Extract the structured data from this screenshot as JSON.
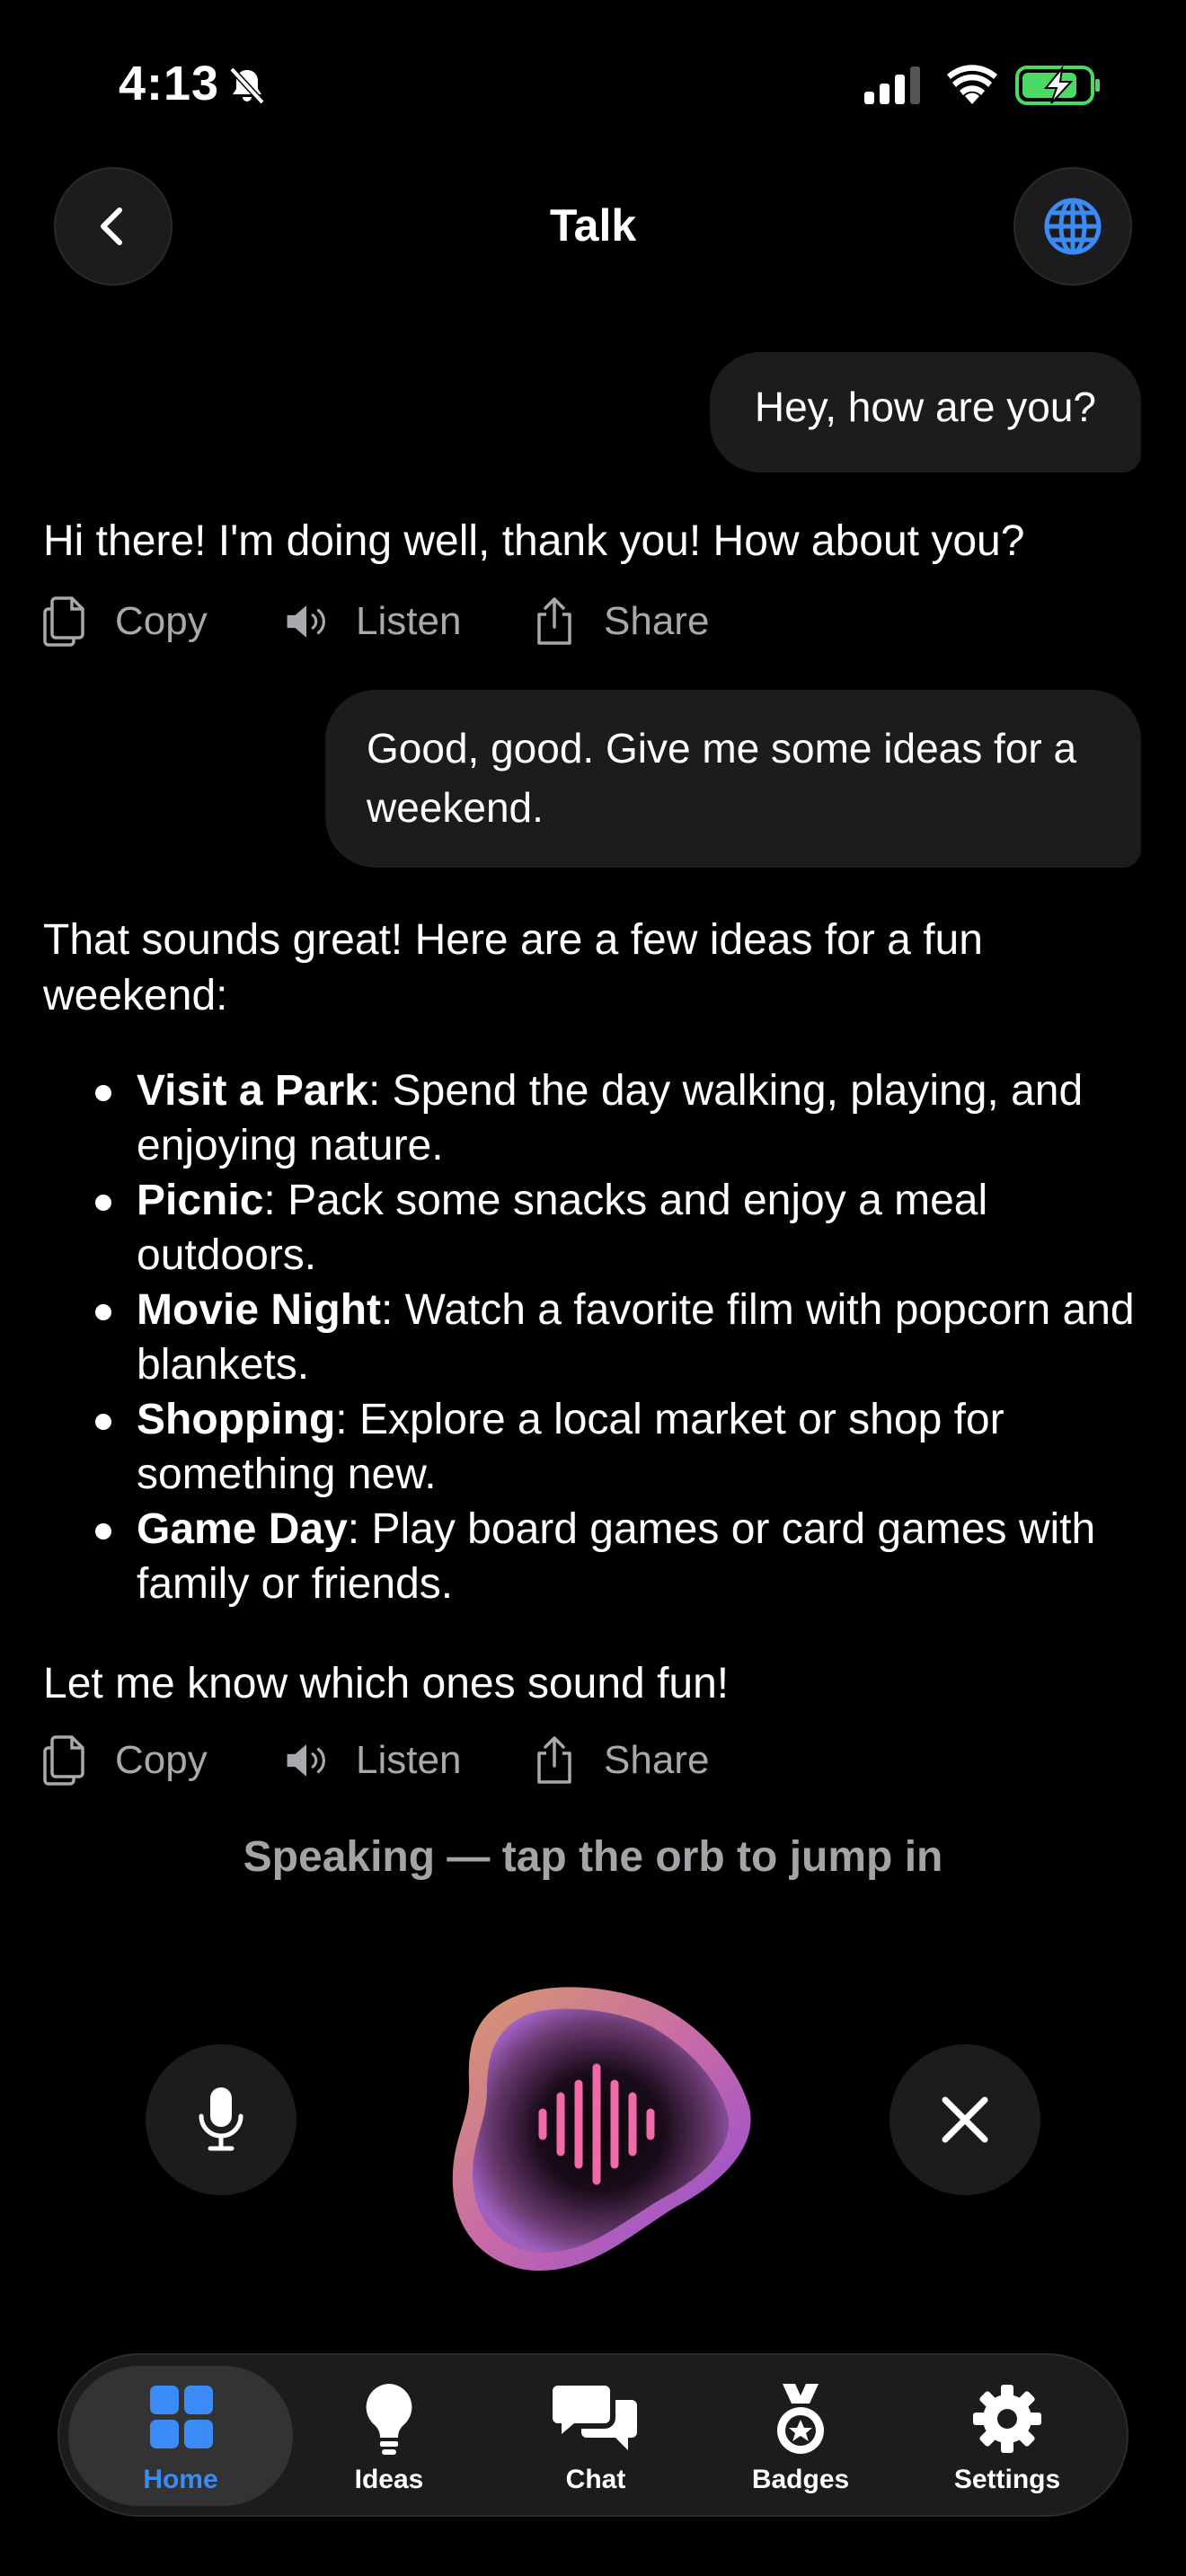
{
  "status_bar": {
    "time": "4:13",
    "silent_icon": "bell-slash-icon",
    "signal_icon": "cellular-signal-icon",
    "wifi_icon": "wifi-icon",
    "battery_icon": "battery-charging-icon"
  },
  "header": {
    "title": "Talk",
    "back_icon": "chevron-left-icon",
    "language_icon": "globe-icon"
  },
  "messages": [
    {
      "role": "user",
      "text": "Hey, how are you?"
    },
    {
      "role": "assistant",
      "text": "Hi there! I'm doing well, thank you! How about you?"
    },
    {
      "role": "user",
      "text": "Good, good. Give me some ideas for a weekend."
    },
    {
      "role": "assistant",
      "intro": "That sounds great! Here are a few ideas for a fun weekend:",
      "ideas": [
        {
          "title": "Visit a Park",
          "detail": ": Spend the day walking, playing, and enjoying nature."
        },
        {
          "title": "Picnic",
          "detail": ": Pack some snacks and enjoy a meal outdoors."
        },
        {
          "title": "Movie Night",
          "detail": ": Watch a favorite film with popcorn and blankets."
        },
        {
          "title": "Shopping",
          "detail": ": Explore a local market or shop for something new."
        },
        {
          "title": "Game Day",
          "detail": ": Play board games or card games with family or friends."
        }
      ],
      "outro": "Let me know which ones sound fun!"
    }
  ],
  "actions": {
    "copy": "Copy",
    "listen": "Listen",
    "share": "Share"
  },
  "speaking_status": "Speaking — tap the orb to jump in",
  "voice_controls": {
    "mic_icon": "microphone-icon",
    "orb_icon": "waveform-icon",
    "close_icon": "close-icon"
  },
  "tabs": [
    {
      "label": "Home",
      "icon": "grid-icon",
      "active": true
    },
    {
      "label": "Ideas",
      "icon": "lightbulb-icon",
      "active": false
    },
    {
      "label": "Chat",
      "icon": "chat-bubbles-icon",
      "active": false
    },
    {
      "label": "Badges",
      "icon": "medal-icon",
      "active": false
    },
    {
      "label": "Settings",
      "icon": "gear-icon",
      "active": false
    }
  ],
  "colors": {
    "accent": "#3b8bf7",
    "bubble": "#1c1c1e",
    "muted_text": "#a8a8ad",
    "battery_green": "#4cd964",
    "orb_pink": "#f06aa8"
  }
}
